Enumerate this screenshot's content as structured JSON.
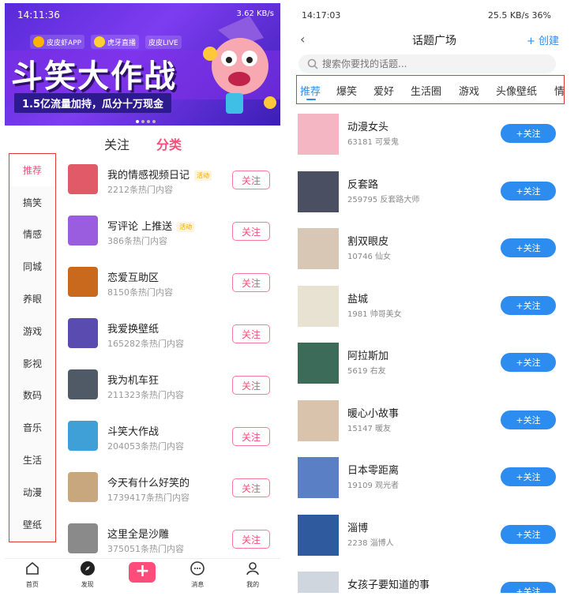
{
  "left": {
    "status": {
      "time": "14:11:36",
      "right": "3.62 KB/s"
    },
    "banner": {
      "logos": [
        "皮皮虾APP",
        "虎牙直播",
        "皮皮LIVE"
      ],
      "title": "斗笑大作战",
      "subtitle": "1.5亿流量加持，瓜分十万现金"
    },
    "tabs": {
      "follow": "关注",
      "category": "分类"
    },
    "categories": [
      "推荐",
      "搞笑",
      "情感",
      "同城",
      "养眼",
      "游戏",
      "影视",
      "数码",
      "音乐",
      "生活",
      "动漫",
      "壁纸"
    ],
    "topics": [
      {
        "name": "我的情感视频日记",
        "tag": "活动",
        "count": "2212条热门内容",
        "follow": "关注",
        "color": "#e05a68"
      },
      {
        "name": "写评论 上推送",
        "tag": "活动",
        "count": "386条热门内容",
        "follow": "关注",
        "color": "#9a5de0"
      },
      {
        "name": "恋爱互助区",
        "tag": "",
        "count": "8150条热门内容",
        "follow": "关注",
        "color": "#c8691e"
      },
      {
        "name": "我爱换壁纸",
        "tag": "",
        "count": "165282条热门内容",
        "follow": "关注",
        "color": "#5a4bb0"
      },
      {
        "name": "我为机车狂",
        "tag": "",
        "count": "211323条热门内容",
        "follow": "关注",
        "color": "#4f5a66"
      },
      {
        "name": "斗笑大作战",
        "tag": "",
        "count": "204053条热门内容",
        "follow": "关注",
        "color": "#3fa0d8"
      },
      {
        "name": "今天有什么好笑的",
        "tag": "",
        "count": "1739417条热门内容",
        "follow": "关注",
        "color": "#c9a77e"
      },
      {
        "name": "这里全是沙雕",
        "tag": "",
        "count": "375051条热门内容",
        "follow": "关注",
        "color": "#8a8a8a"
      }
    ],
    "bottom_nav": [
      "首页",
      "发现",
      "",
      "消息",
      "我的"
    ]
  },
  "right": {
    "status": {
      "time": "14:17:03",
      "right": "25.5 KB/s  36%"
    },
    "header": {
      "back": "‹",
      "title": "话题广场",
      "create": "+ 创建"
    },
    "search_placeholder": "搜索你要找的话题...",
    "cat_tabs": [
      "推荐",
      "爆笑",
      "爱好",
      "生活圈",
      "游戏",
      "头像壁纸",
      "情"
    ],
    "topics": [
      {
        "name": "动漫女头",
        "sub": "63181 可爱鬼",
        "follow": "+关注",
        "color": "#f3b6c2"
      },
      {
        "name": "反套路",
        "sub": "259795 反套路大师",
        "follow": "+关注",
        "color": "#4a4f62"
      },
      {
        "name": "割双眼皮",
        "sub": "10746 仙女",
        "follow": "+关注",
        "color": "#d8c7b5"
      },
      {
        "name": "盐城",
        "sub": "1981 帅哥美女",
        "follow": "+关注",
        "color": "#e8e2d3"
      },
      {
        "name": "阿拉斯加",
        "sub": "5619 右友",
        "follow": "+关注",
        "color": "#3d6b5a"
      },
      {
        "name": "暖心小故事",
        "sub": "15147 暖友",
        "follow": "+关注",
        "color": "#d9c3ac"
      },
      {
        "name": "日本零距离",
        "sub": "19109 观光者",
        "follow": "+关注",
        "color": "#5b7fc4"
      },
      {
        "name": "淄博",
        "sub": "2238 淄博人",
        "follow": "+关注",
        "color": "#2f5a9e"
      },
      {
        "name": "女孩子要知道的事",
        "sub": "",
        "follow": "+关注",
        "color": "#cfd6dd"
      }
    ]
  }
}
